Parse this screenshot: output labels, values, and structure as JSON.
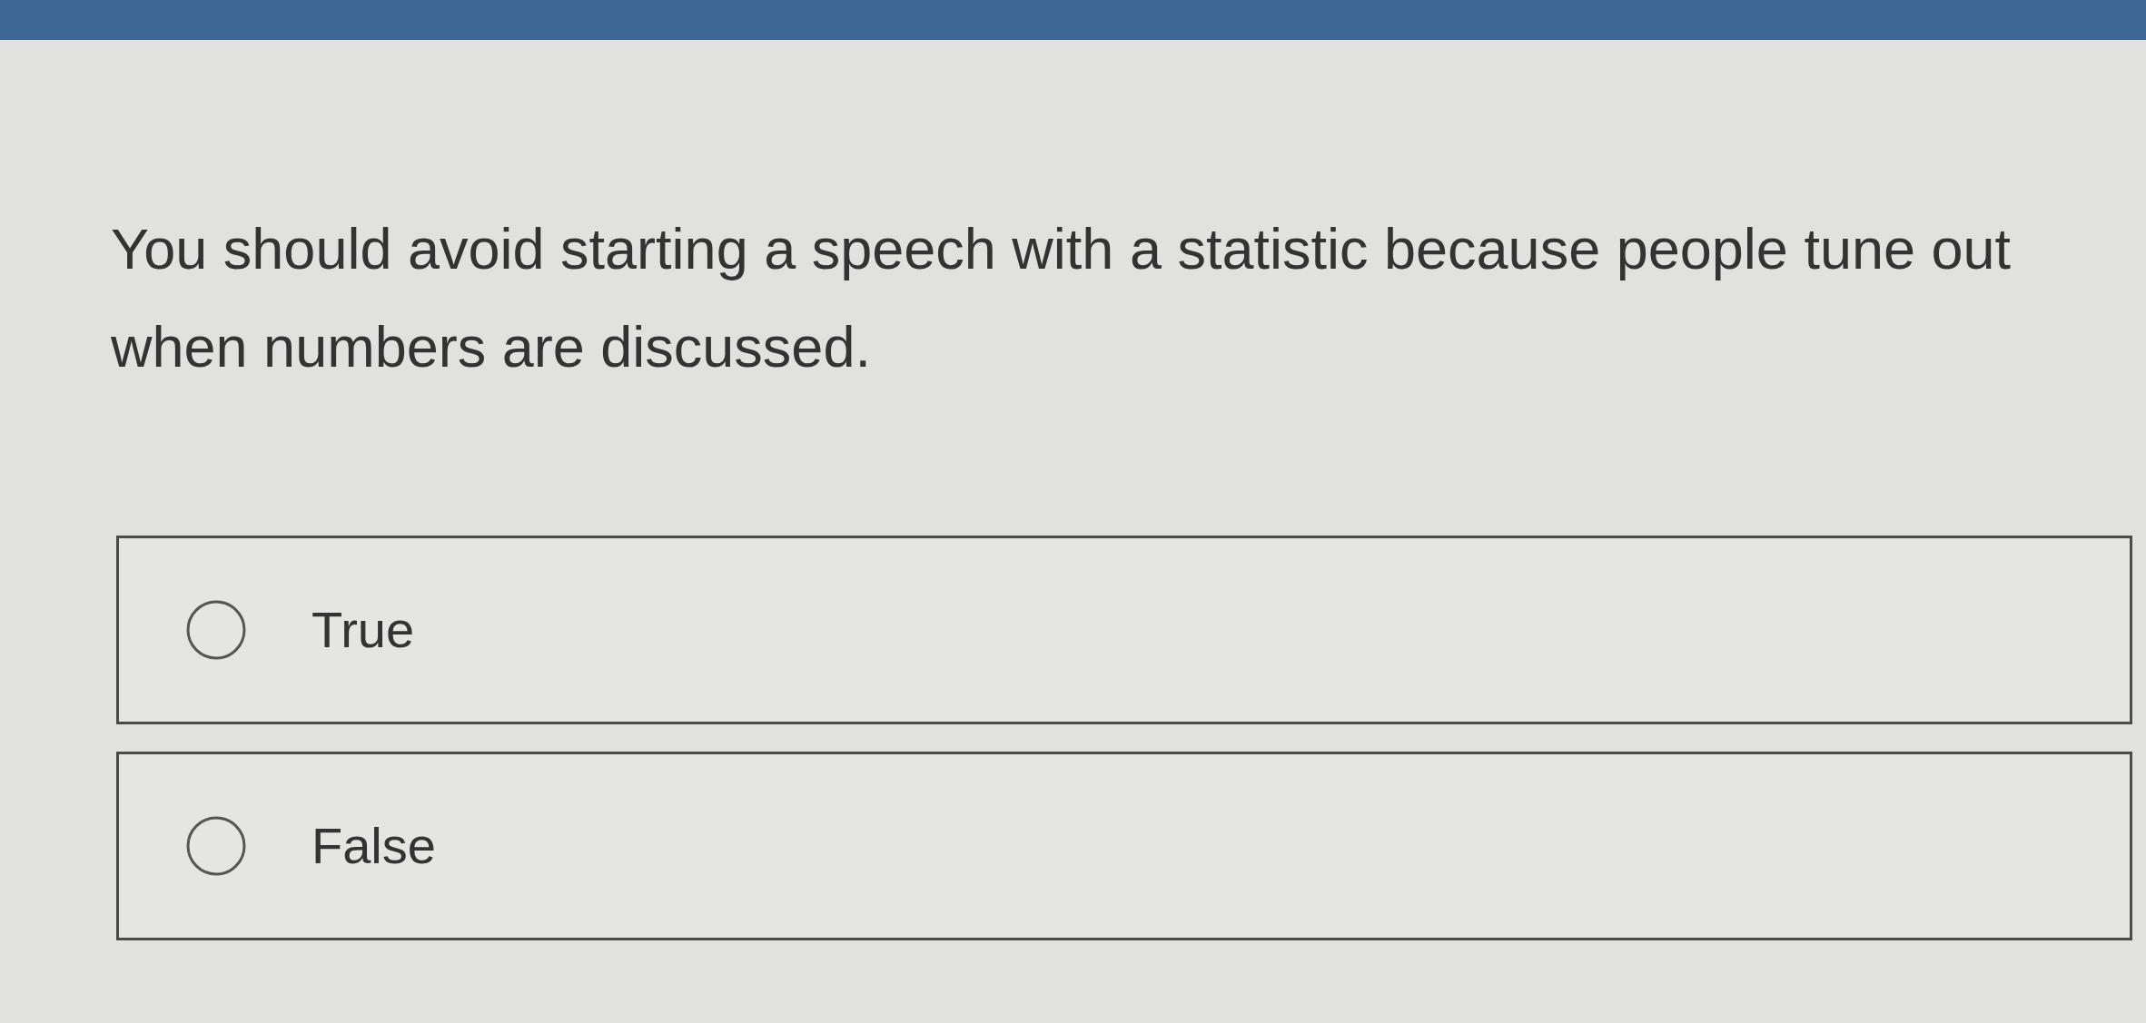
{
  "question": "You should avoid starting a speech with a statistic because people tune out when numbers are discussed.",
  "options": [
    {
      "label": "True",
      "selected": false
    },
    {
      "label": "False",
      "selected": false
    }
  ]
}
